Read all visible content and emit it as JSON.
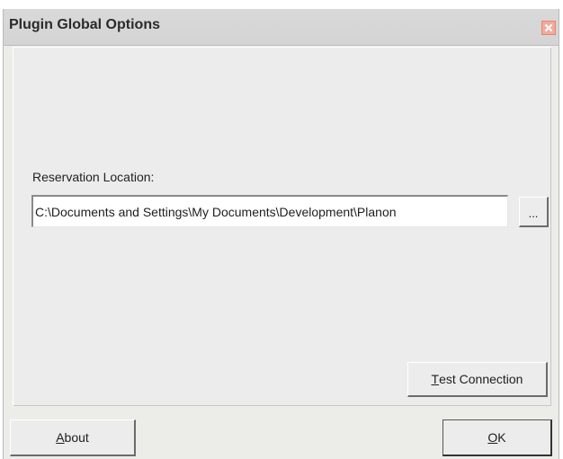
{
  "window": {
    "title": "Plugin Global Options"
  },
  "form": {
    "reservation_label": "Reservation Location:",
    "reservation_path": "C:\\Documents and Settings\\My Documents\\Development\\Planon",
    "browse_label": "..."
  },
  "buttons": {
    "test_connection": {
      "mnemonic": "T",
      "rest": "est Connection"
    },
    "about": {
      "mnemonic": "A",
      "rest": "bout"
    },
    "ok": {
      "mnemonic": "O",
      "rest": "K"
    }
  },
  "icons": {
    "close": "close-icon"
  },
  "colors": {
    "window_bg": "#ecece9",
    "close_button": "#f3aa9c"
  }
}
